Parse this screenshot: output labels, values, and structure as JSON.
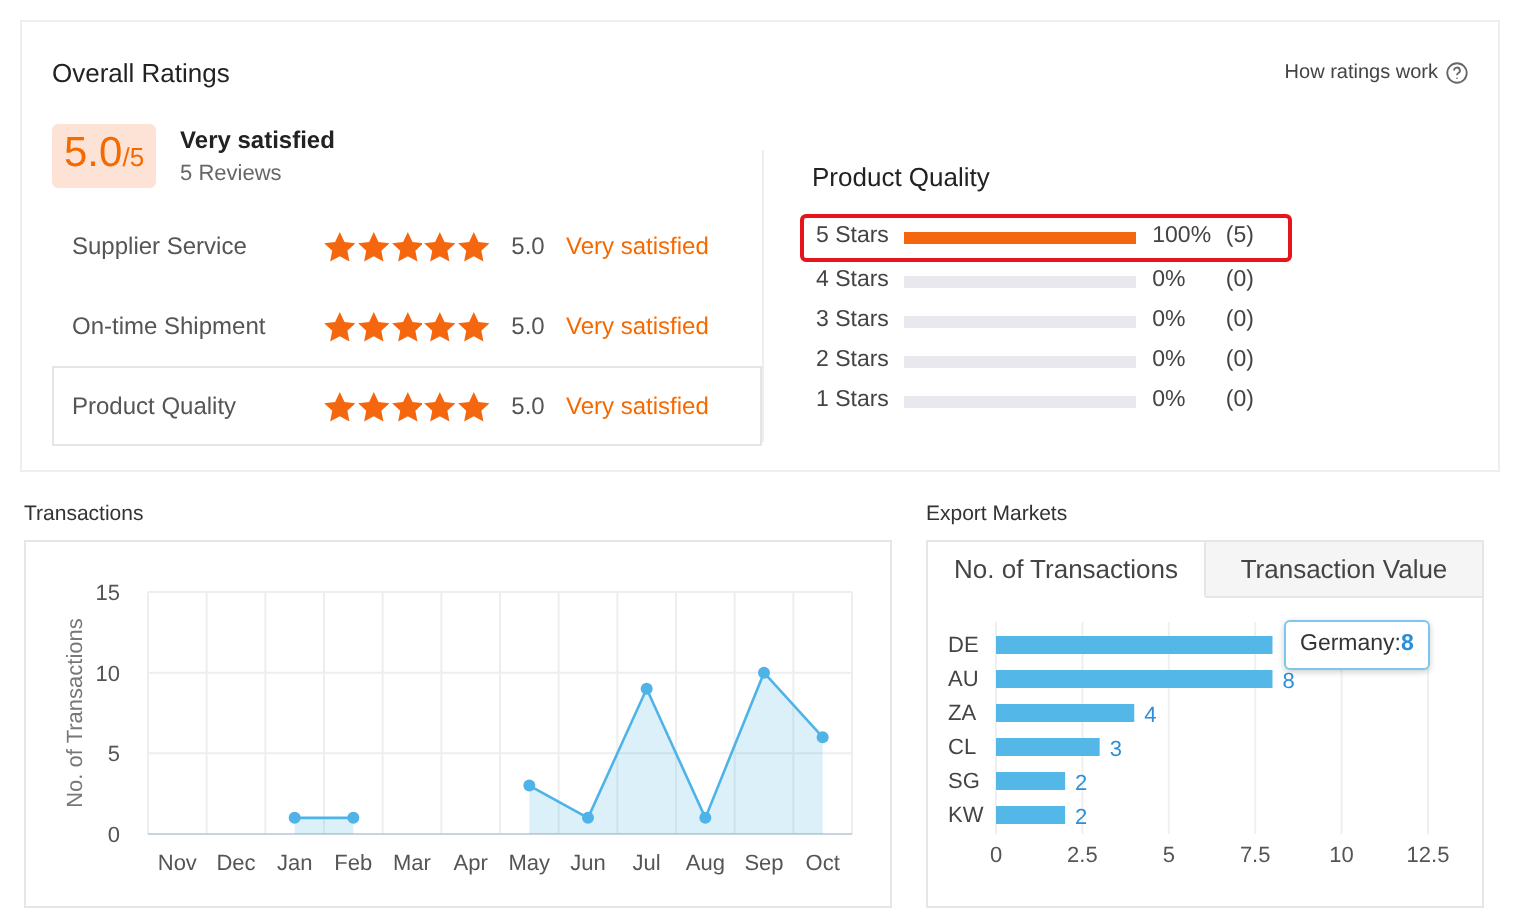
{
  "ratings": {
    "title": "Overall Ratings",
    "help_link": "How ratings work",
    "score": "5.0",
    "score_max": "/5",
    "summary": "Very satisfied",
    "reviews": "5 Reviews",
    "categories": [
      {
        "name": "Supplier Service",
        "stars": 5,
        "value": "5.0",
        "label": "Very satisfied",
        "selected": false
      },
      {
        "name": "On-time Shipment",
        "stars": 5,
        "value": "5.0",
        "label": "Very satisfied",
        "selected": false
      },
      {
        "name": "Product Quality",
        "stars": 5,
        "value": "5.0",
        "label": "Very satisfied",
        "selected": true
      }
    ],
    "breakdown": {
      "title": "Product Quality",
      "rows": [
        {
          "label": "5 Stars",
          "level": 1,
          "percent": "100%",
          "count": "(5)",
          "highlighted": true
        },
        {
          "label": "4 Stars",
          "level": 0,
          "percent": "0%",
          "count": "(0)",
          "highlighted": false
        },
        {
          "label": "3 Stars",
          "level": 0,
          "percent": "0%",
          "count": "(0)",
          "highlighted": false
        },
        {
          "label": "2 Stars",
          "level": 0,
          "percent": "0%",
          "count": "(0)",
          "highlighted": false
        },
        {
          "label": "1 Stars",
          "level": 0,
          "percent": "0%",
          "count": "(0)",
          "highlighted": false
        }
      ]
    }
  },
  "transactions": {
    "title": "Transactions",
    "chart_data": {
      "type": "area",
      "ylabel": "No. of Transactions",
      "categories": [
        "Nov",
        "Dec",
        "Jan",
        "Feb",
        "Mar",
        "Apr",
        "May",
        "Jun",
        "Jul",
        "Aug",
        "Sep",
        "Oct"
      ],
      "series": [
        {
          "color": "#4fb3e8",
          "values": [
            null,
            null,
            1,
            1,
            null,
            null,
            3,
            1,
            9,
            1,
            10,
            6
          ]
        }
      ],
      "ylim": [
        0,
        15
      ],
      "yticks": [
        0,
        5,
        10,
        15
      ],
      "grid": true
    }
  },
  "export_markets": {
    "title": "Export Markets",
    "tabs": [
      {
        "label": "No. of Transactions",
        "selected": true
      },
      {
        "label": "Transaction Value",
        "selected": false
      }
    ],
    "chart_data": {
      "type": "bar",
      "orientation": "horizontal",
      "categories": [
        "DE",
        "AU",
        "ZA",
        "CL",
        "SG",
        "KW"
      ],
      "series": [
        {
          "color": "#53b7e8",
          "values": [
            8,
            8,
            4,
            3,
            2,
            2
          ]
        }
      ],
      "xlim": [
        0,
        12.5
      ],
      "xticks": [
        0,
        {
          "value": 2.5,
          "label": "2.5"
        },
        5,
        {
          "value": 7.5,
          "label": "7.5"
        },
        10,
        {
          "value": 12.5,
          "label": "12.5"
        }
      ],
      "value_labels": [
        null,
        "8",
        "4",
        "3",
        "2",
        "2"
      ],
      "grid": true
    },
    "tooltip": {
      "label": "Germany:",
      "value": "8"
    }
  }
}
